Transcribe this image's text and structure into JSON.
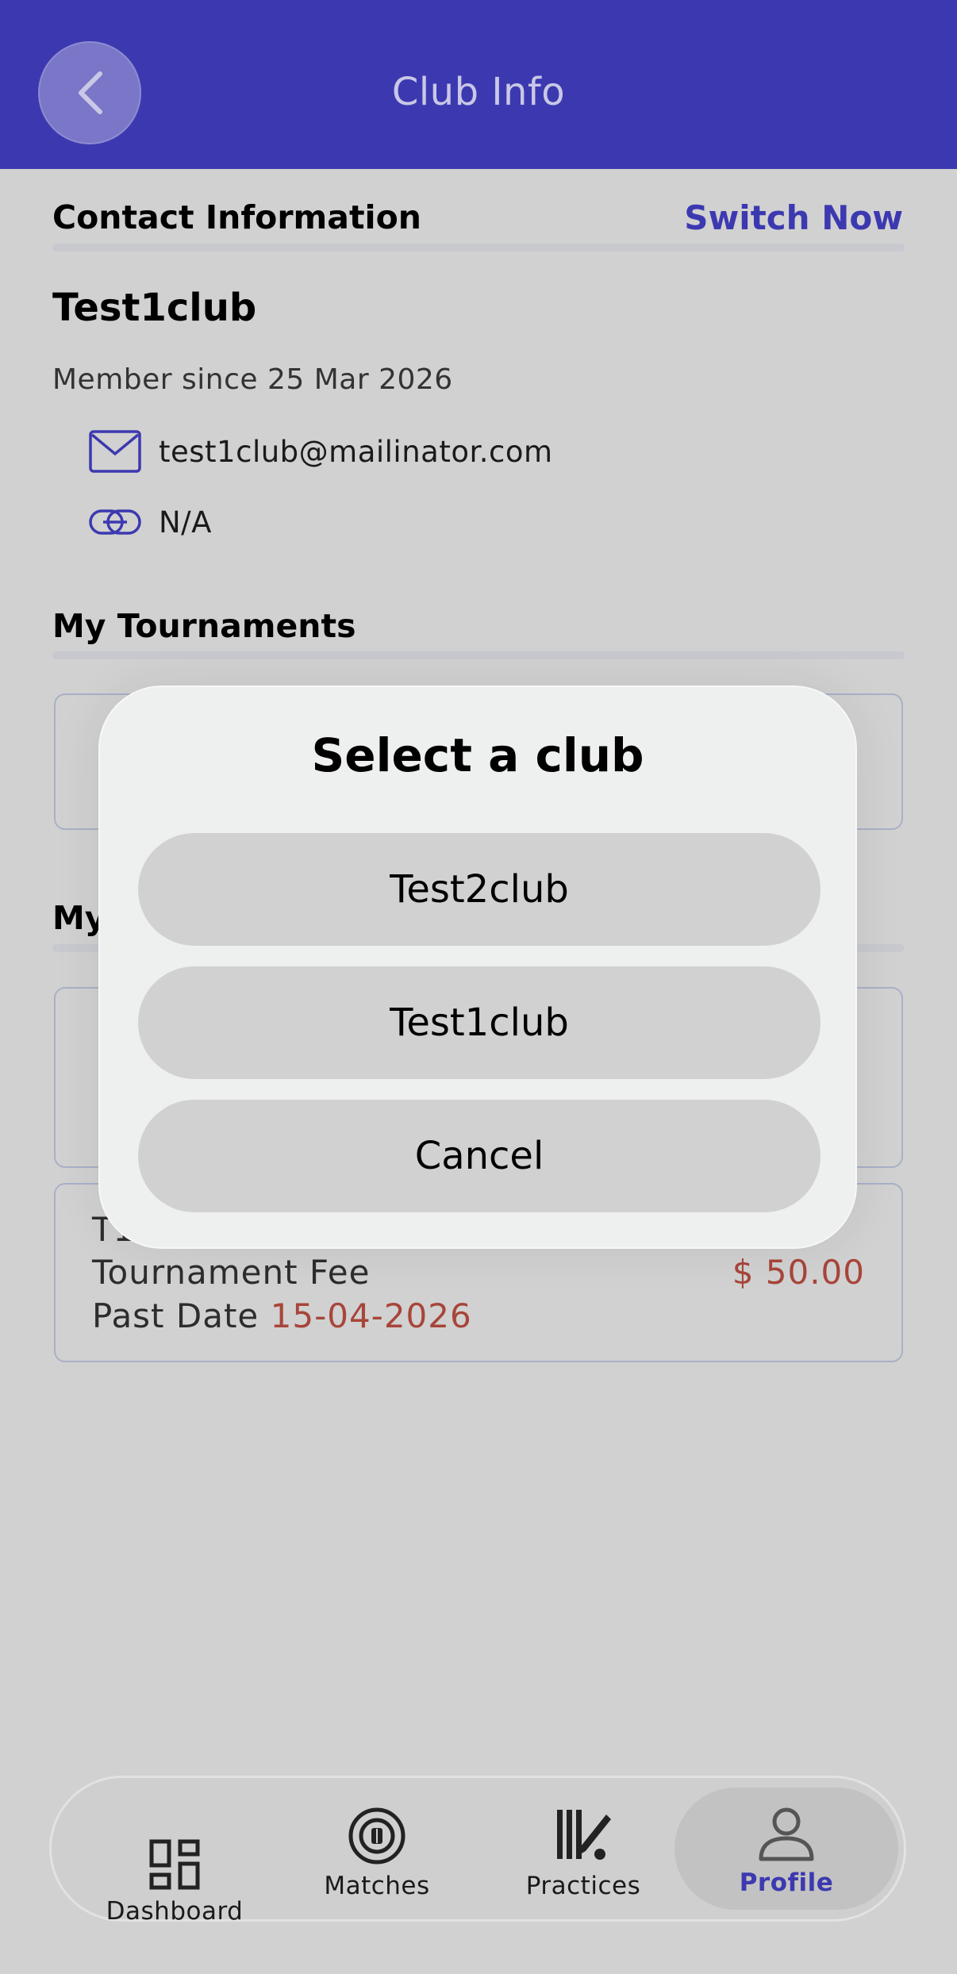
{
  "header": {
    "title": "Club Info"
  },
  "contact": {
    "section_title": "Contact Information",
    "switch_label": "Switch Now",
    "club_name": "Test1club",
    "member_since": "Member since 25 Mar 2026",
    "email": "test1club@mailinator.com",
    "website": "N/A"
  },
  "tournaments": {
    "section_title": "My Tournaments"
  },
  "second_section": {
    "title_visible": "My"
  },
  "fee_card": {
    "name_partial": "T1",
    "fee_label": "Tournament Fee",
    "fee_value": "$ 50.00",
    "date_label": "Past Date",
    "date_value": "15-04-2026"
  },
  "modal": {
    "title": "Select a club",
    "options": [
      "Test2club",
      "Test1club"
    ],
    "cancel_label": "Cancel"
  },
  "tabbar": {
    "items": [
      {
        "label": "Dashboard",
        "icon": "dashboard-icon"
      },
      {
        "label": "Matches",
        "icon": "matches-icon"
      },
      {
        "label": "Practices",
        "icon": "practices-icon"
      },
      {
        "label": "Profile",
        "icon": "profile-icon",
        "active": true
      }
    ]
  },
  "colors": {
    "primary": "#3c39b0",
    "accent_red": "#a8453a",
    "overlay": "#d1d1d1"
  }
}
